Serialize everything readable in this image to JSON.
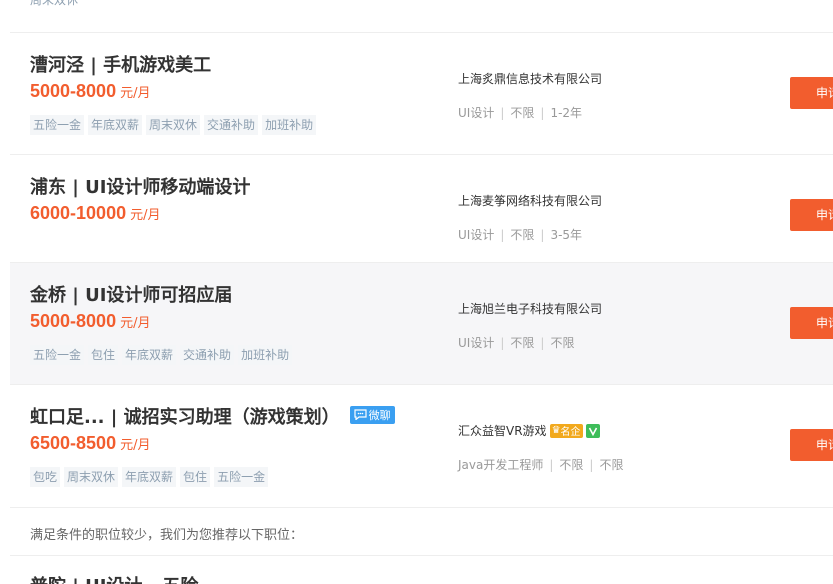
{
  "top_partial": {
    "tag": "周末双休"
  },
  "jobs": [
    {
      "title": "漕河泾 | 手机游戏美工",
      "salary": "5000-8000",
      "unit": "元/月",
      "tags": [
        "五险一金",
        "年底双薪",
        "周末双休",
        "交通补助",
        "加班补助"
      ],
      "company": "上海炙鼎信息技术有限公司",
      "category": "UI设计",
      "education": "不限",
      "experience": "1-2年",
      "apply": "申请"
    },
    {
      "title": "浦东 | UI设计师移动端设计",
      "salary": "6000-10000",
      "unit": "元/月",
      "tags": [],
      "company": "上海麦筝网络科技有限公司",
      "category": "UI设计",
      "education": "不限",
      "experience": "3-5年",
      "apply": "申请"
    },
    {
      "title": "金桥 | UI设计师可招应届",
      "salary": "5000-8000",
      "unit": "元/月",
      "tags": [
        "五险一金",
        "包住",
        "年底双薪",
        "交通补助",
        "加班补助"
      ],
      "company": "上海旭兰电子科技有限公司",
      "category": "UI设计",
      "education": "不限",
      "experience": "不限",
      "apply": "申请"
    },
    {
      "title": "虹口足... | 诚招实习助理（游戏策划）",
      "wechat_badge": "微聊",
      "salary": "6500-8500",
      "unit": "元/月",
      "tags": [
        "包吃",
        "周末双休",
        "年底双薪",
        "包住",
        "五险一金"
      ],
      "company": "汇众益智VR游戏",
      "famous_badge": "名企",
      "category": "Java开发工程师",
      "education": "不限",
      "experience": "不限",
      "apply": "申请"
    }
  ],
  "notice": "满足条件的职位较少，我们为您推荐以下职位：",
  "bottom_partial": "普陀 | UI设计 - 五险"
}
